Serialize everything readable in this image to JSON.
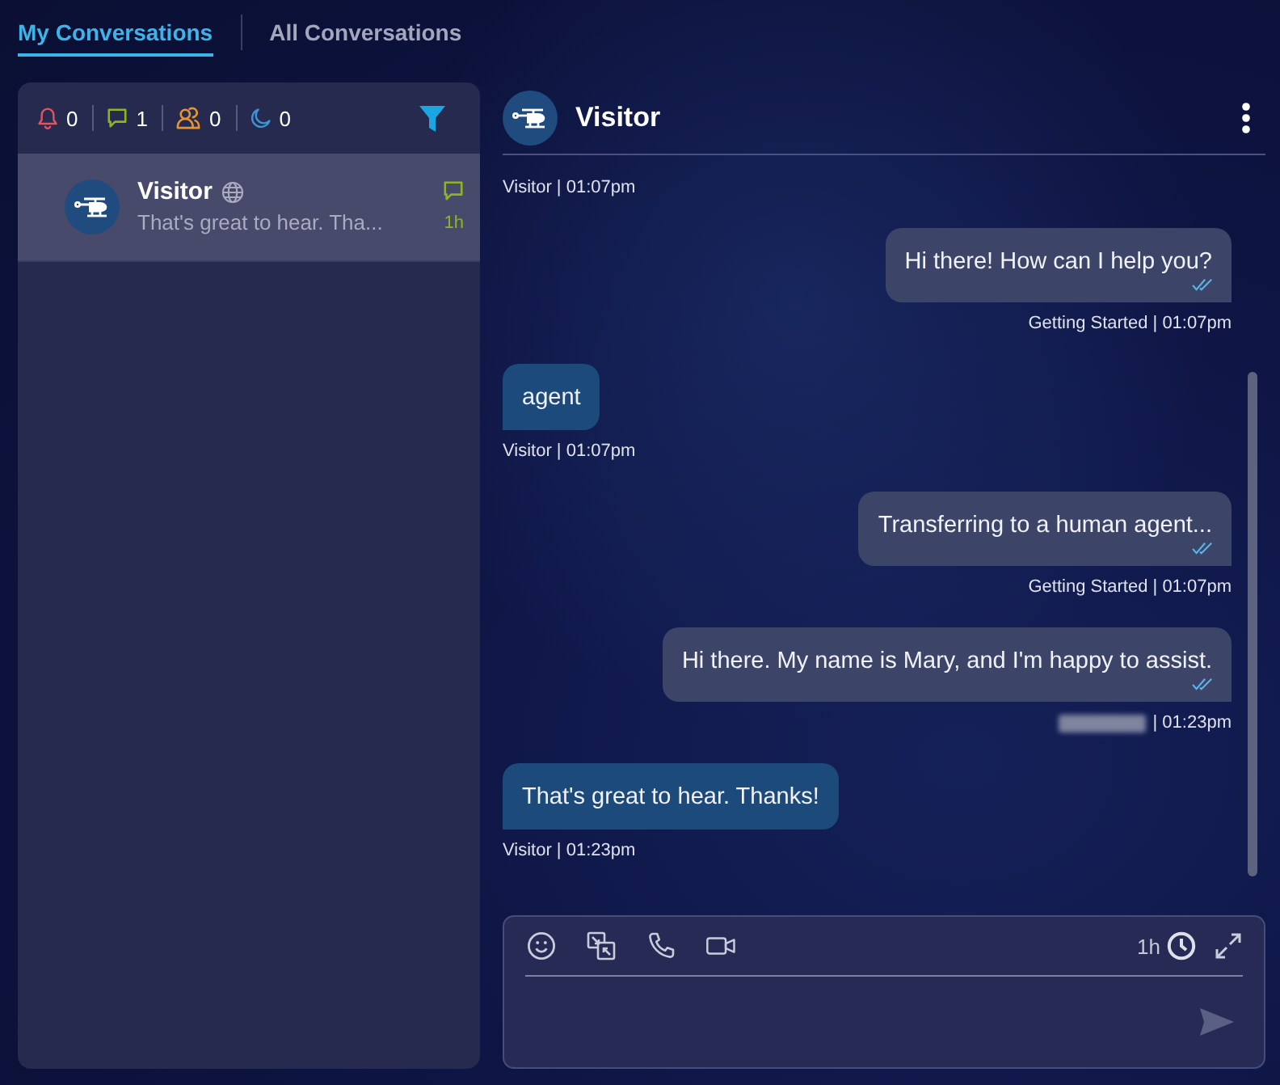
{
  "tabs": [
    {
      "label": "My Conversations",
      "selected": true
    },
    {
      "label": "All Conversations",
      "selected": false
    }
  ],
  "counters": [
    {
      "kind": "alerts",
      "color": "#e2535f",
      "count": "0"
    },
    {
      "kind": "chats",
      "color": "#8cb61f",
      "count": "1"
    },
    {
      "kind": "agents",
      "color": "#e8942c",
      "count": "0"
    },
    {
      "kind": "away",
      "color": "#3b94d6",
      "count": "0"
    }
  ],
  "conversations": [
    {
      "name": "Visitor",
      "preview": "That's great to hear. Tha...",
      "time": "1h",
      "selected": true
    }
  ],
  "chat": {
    "title": "Visitor",
    "messages": [
      {
        "kind": "incoming",
        "meta": "Visitor | 01:07pm"
      },
      {
        "kind": "outgoing",
        "text": "Hi there! How can I help you?",
        "read": true,
        "meta": "Getting Started | 01:07pm"
      },
      {
        "kind": "incoming",
        "text": "agent",
        "meta": "Visitor | 01:07pm"
      },
      {
        "kind": "outgoing",
        "text": "Transferring to a human agent...",
        "read": true,
        "meta": "Getting Started | 01:07pm"
      },
      {
        "kind": "outgoing",
        "text": "Hi there. My name is Mary, and I'm happy to assist.",
        "read": true,
        "sender_redacted": true,
        "meta": "| 01:23pm"
      },
      {
        "kind": "incoming",
        "text": "That's great to hear. Thanks!",
        "meta": "Visitor | 01:23pm"
      }
    ]
  },
  "composer": {
    "timer": "1h",
    "send_disabled": true
  }
}
